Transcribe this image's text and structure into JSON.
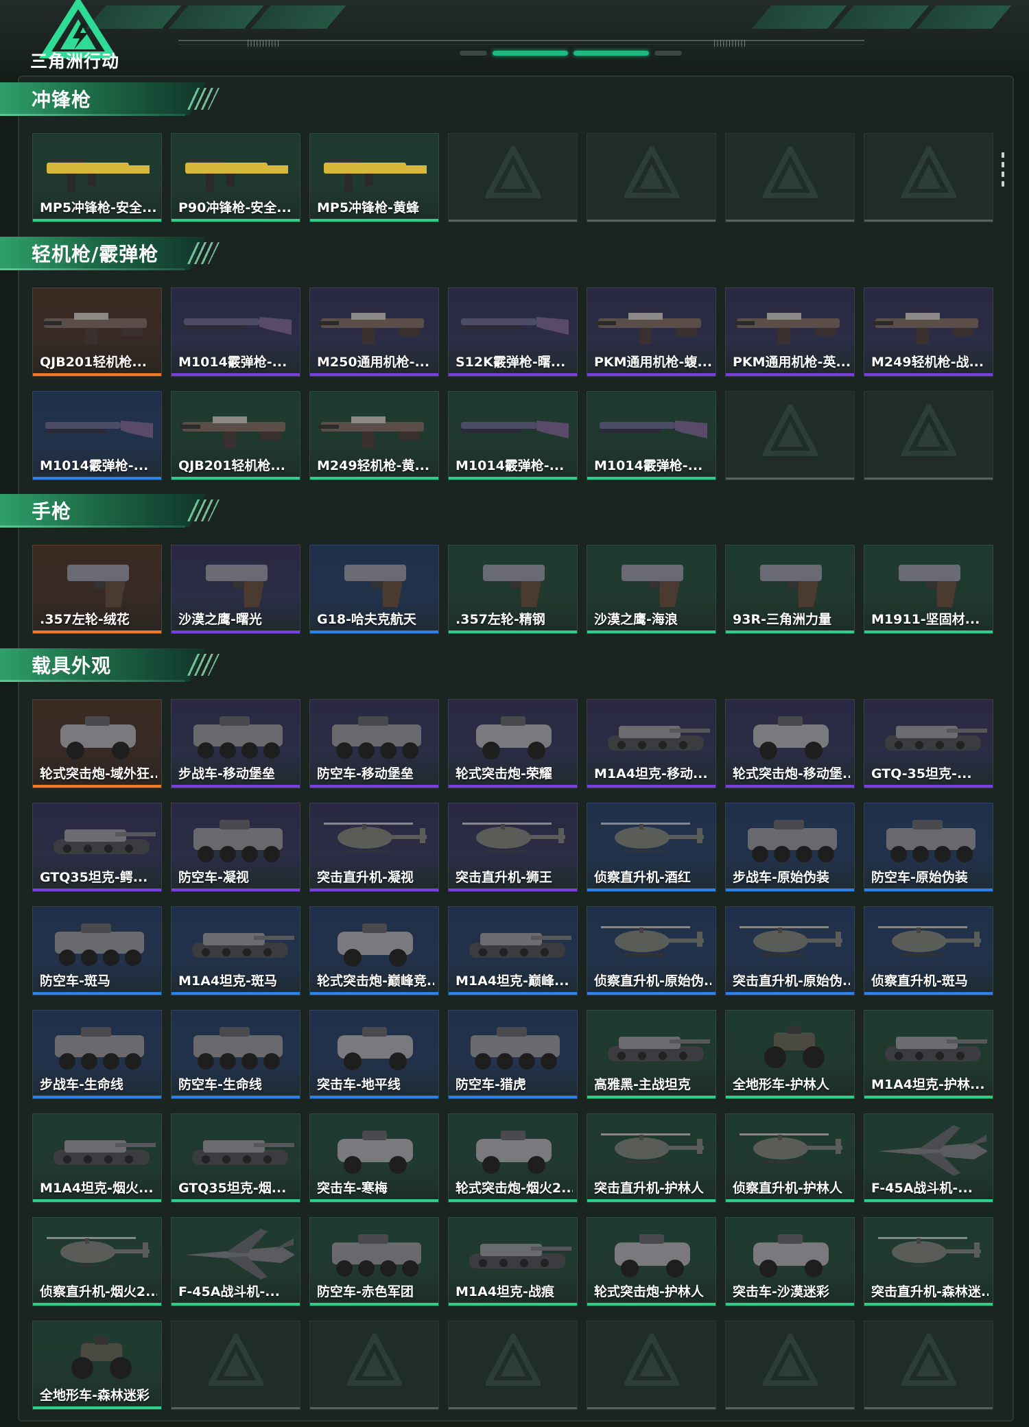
{
  "app": {
    "logo_text": "三角洲行动"
  },
  "sections": [
    {
      "title": "冲锋枪",
      "items": [
        {
          "name": "MP5冲锋枪-安全...",
          "rarity": "green",
          "icon": "smg-icon"
        },
        {
          "name": "P90冲锋枪-安全...",
          "rarity": "green",
          "icon": "smg-icon"
        },
        {
          "name": "MP5冲锋枪-黄蜂",
          "rarity": "green",
          "icon": "smg-icon"
        },
        {
          "empty": true
        },
        {
          "empty": true
        },
        {
          "empty": true
        },
        {
          "empty": true
        }
      ]
    },
    {
      "title": "轻机枪/霰弹枪",
      "items": [
        {
          "name": "QJB201轻机枪...",
          "rarity": "orange",
          "icon": "lmg-icon"
        },
        {
          "name": "M1014霰弹枪-...",
          "rarity": "purple",
          "icon": "shotgun-icon"
        },
        {
          "name": "M250通用机枪-...",
          "rarity": "purple",
          "icon": "lmg-icon"
        },
        {
          "name": "S12K霰弹枪-曙...",
          "rarity": "purple",
          "icon": "shotgun-icon"
        },
        {
          "name": "PKM通用机枪-蝮...",
          "rarity": "purple",
          "icon": "lmg-icon"
        },
        {
          "name": "PKM通用机枪-英...",
          "rarity": "purple",
          "icon": "lmg-icon"
        },
        {
          "name": "M249轻机枪-战...",
          "rarity": "purple",
          "icon": "lmg-icon"
        },
        {
          "name": "M1014霰弹枪-...",
          "rarity": "blue",
          "icon": "shotgun-icon"
        },
        {
          "name": "QJB201轻机枪...",
          "rarity": "green",
          "icon": "lmg-icon"
        },
        {
          "name": "M249轻机枪-黄...",
          "rarity": "green",
          "icon": "lmg-icon"
        },
        {
          "name": "M1014霰弹枪-...",
          "rarity": "green",
          "icon": "shotgun-icon"
        },
        {
          "name": "M1014霰弹枪-...",
          "rarity": "green",
          "icon": "shotgun-icon"
        },
        {
          "empty": true
        },
        {
          "empty": true
        }
      ]
    },
    {
      "title": "手枪",
      "items": [
        {
          "name": ".357左轮-绒花",
          "rarity": "orange",
          "icon": "pistol-icon"
        },
        {
          "name": "沙漠之鹰-曙光",
          "rarity": "purple",
          "icon": "pistol-icon"
        },
        {
          "name": "G18-哈夫克航天",
          "rarity": "blue",
          "icon": "pistol-icon"
        },
        {
          "name": ".357左轮-精钢",
          "rarity": "green",
          "icon": "pistol-icon"
        },
        {
          "name": "沙漠之鹰-海浪",
          "rarity": "green",
          "icon": "pistol-icon"
        },
        {
          "name": "93R-三角洲力量",
          "rarity": "green",
          "icon": "pistol-icon"
        },
        {
          "name": "M1911-坚固材...",
          "rarity": "green",
          "icon": "pistol-icon"
        }
      ]
    },
    {
      "title": "载具外观",
      "items": [
        {
          "name": "轮式突击炮-域外狂...",
          "rarity": "orange",
          "icon": "armored-car-icon"
        },
        {
          "name": "步战车-移动堡垒",
          "rarity": "purple",
          "icon": "ifv-icon"
        },
        {
          "name": "防空车-移动堡垒",
          "rarity": "purple",
          "icon": "ifv-icon"
        },
        {
          "name": "轮式突击炮-荣耀",
          "rarity": "purple",
          "icon": "armored-car-icon"
        },
        {
          "name": "M1A4坦克-移动...",
          "rarity": "purple",
          "icon": "tank-icon"
        },
        {
          "name": "轮式突击炮-移动堡...",
          "rarity": "purple",
          "icon": "armored-car-icon"
        },
        {
          "name": "GTQ-35坦克-...",
          "rarity": "purple",
          "icon": "tank-icon"
        },
        {
          "name": "GTQ35坦克-鳄...",
          "rarity": "purple",
          "icon": "tank-icon"
        },
        {
          "name": "防空车-凝视",
          "rarity": "purple",
          "icon": "ifv-icon"
        },
        {
          "name": "突击直升机-凝视",
          "rarity": "purple",
          "icon": "helicopter-icon"
        },
        {
          "name": "突击直升机-狮王",
          "rarity": "purple",
          "icon": "helicopter-icon"
        },
        {
          "name": "侦察直升机-酒红",
          "rarity": "blue",
          "icon": "helicopter-icon"
        },
        {
          "name": "步战车-原始伪装",
          "rarity": "blue",
          "icon": "ifv-icon"
        },
        {
          "name": "防空车-原始伪装",
          "rarity": "blue",
          "icon": "ifv-icon"
        },
        {
          "name": "防空车-斑马",
          "rarity": "blue",
          "icon": "ifv-icon"
        },
        {
          "name": "M1A4坦克-斑马",
          "rarity": "blue",
          "icon": "tank-icon"
        },
        {
          "name": "轮式突击炮-巅峰竞...",
          "rarity": "blue",
          "icon": "armored-car-icon"
        },
        {
          "name": "M1A4坦克-巅峰...",
          "rarity": "blue",
          "icon": "tank-icon"
        },
        {
          "name": "侦察直升机-原始伪...",
          "rarity": "blue",
          "icon": "helicopter-icon"
        },
        {
          "name": "突击直升机-原始伪...",
          "rarity": "blue",
          "icon": "helicopter-icon"
        },
        {
          "name": "侦察直升机-斑马",
          "rarity": "blue",
          "icon": "helicopter-icon"
        },
        {
          "name": "步战车-生命线",
          "rarity": "blue",
          "icon": "ifv-icon"
        },
        {
          "name": "防空车-生命线",
          "rarity": "blue",
          "icon": "ifv-icon"
        },
        {
          "name": "突击车-地平线",
          "rarity": "blue",
          "icon": "armored-car-icon"
        },
        {
          "name": "防空车-猎虎",
          "rarity": "blue",
          "icon": "ifv-icon"
        },
        {
          "name": "高雅黑-主战坦克",
          "rarity": "green",
          "icon": "tank-icon"
        },
        {
          "name": "全地形车-护林人",
          "rarity": "green",
          "icon": "atv-icon"
        },
        {
          "name": "M1A4坦克-护林...",
          "rarity": "green",
          "icon": "tank-icon"
        },
        {
          "name": "M1A4坦克-烟火...",
          "rarity": "green",
          "icon": "tank-icon"
        },
        {
          "name": "GTQ35坦克-烟...",
          "rarity": "green",
          "icon": "tank-icon"
        },
        {
          "name": "突击车-寒梅",
          "rarity": "green",
          "icon": "armored-car-icon"
        },
        {
          "name": "轮式突击炮-烟火2...",
          "rarity": "green",
          "icon": "armored-car-icon"
        },
        {
          "name": "突击直升机-护林人",
          "rarity": "green",
          "icon": "helicopter-icon"
        },
        {
          "name": "侦察直升机-护林人",
          "rarity": "green",
          "icon": "helicopter-icon"
        },
        {
          "name": "F-45A战斗机-...",
          "rarity": "green",
          "icon": "jet-icon"
        },
        {
          "name": "侦察直升机-烟火2...",
          "rarity": "green",
          "icon": "helicopter-icon"
        },
        {
          "name": "F-45A战斗机-...",
          "rarity": "green",
          "icon": "jet-icon"
        },
        {
          "name": "防空车-赤色军团",
          "rarity": "green",
          "icon": "ifv-icon"
        },
        {
          "name": "M1A4坦克-战痕",
          "rarity": "green",
          "icon": "tank-icon"
        },
        {
          "name": "轮式突击炮-护林人",
          "rarity": "green",
          "icon": "armored-car-icon"
        },
        {
          "name": "突击车-沙漠迷彩",
          "rarity": "green",
          "icon": "armored-car-icon"
        },
        {
          "name": "突击直升机-森林迷...",
          "rarity": "green",
          "icon": "helicopter-icon"
        },
        {
          "name": "全地形车-森林迷彩",
          "rarity": "green",
          "icon": "atv-icon"
        },
        {
          "empty": true
        },
        {
          "empty": true
        },
        {
          "empty": true
        },
        {
          "empty": true
        },
        {
          "empty": true
        },
        {
          "empty": true
        }
      ]
    }
  ],
  "colors": {
    "accent": "#2fcf8a",
    "rarity_orange": "#f07a2a",
    "rarity_purple": "#7a3fe0",
    "rarity_blue": "#2f7fe8",
    "rarity_green": "#2fcf8a"
  }
}
